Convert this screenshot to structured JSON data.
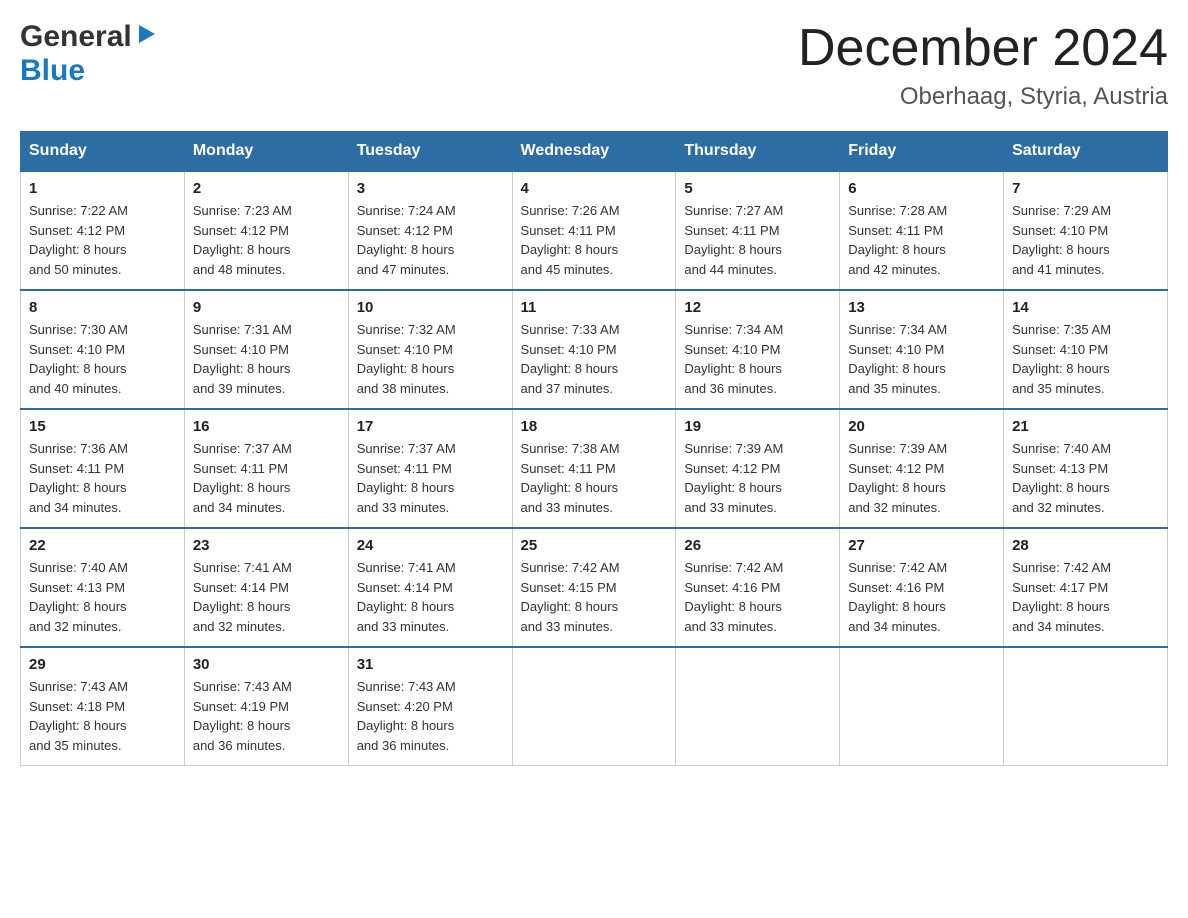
{
  "logo": {
    "general": "General",
    "blue": "Blue",
    "arrow": "▶"
  },
  "title": {
    "month_year": "December 2024",
    "location": "Oberhaag, Styria, Austria"
  },
  "days_of_week": [
    "Sunday",
    "Monday",
    "Tuesday",
    "Wednesday",
    "Thursday",
    "Friday",
    "Saturday"
  ],
  "weeks": [
    [
      {
        "day": "1",
        "sunrise": "7:22 AM",
        "sunset": "4:12 PM",
        "daylight_hours": "8",
        "daylight_minutes": "50"
      },
      {
        "day": "2",
        "sunrise": "7:23 AM",
        "sunset": "4:12 PM",
        "daylight_hours": "8",
        "daylight_minutes": "48"
      },
      {
        "day": "3",
        "sunrise": "7:24 AM",
        "sunset": "4:12 PM",
        "daylight_hours": "8",
        "daylight_minutes": "47"
      },
      {
        "day": "4",
        "sunrise": "7:26 AM",
        "sunset": "4:11 PM",
        "daylight_hours": "8",
        "daylight_minutes": "45"
      },
      {
        "day": "5",
        "sunrise": "7:27 AM",
        "sunset": "4:11 PM",
        "daylight_hours": "8",
        "daylight_minutes": "44"
      },
      {
        "day": "6",
        "sunrise": "7:28 AM",
        "sunset": "4:11 PM",
        "daylight_hours": "8",
        "daylight_minutes": "42"
      },
      {
        "day": "7",
        "sunrise": "7:29 AM",
        "sunset": "4:10 PM",
        "daylight_hours": "8",
        "daylight_minutes": "41"
      }
    ],
    [
      {
        "day": "8",
        "sunrise": "7:30 AM",
        "sunset": "4:10 PM",
        "daylight_hours": "8",
        "daylight_minutes": "40"
      },
      {
        "day": "9",
        "sunrise": "7:31 AM",
        "sunset": "4:10 PM",
        "daylight_hours": "8",
        "daylight_minutes": "39"
      },
      {
        "day": "10",
        "sunrise": "7:32 AM",
        "sunset": "4:10 PM",
        "daylight_hours": "8",
        "daylight_minutes": "38"
      },
      {
        "day": "11",
        "sunrise": "7:33 AM",
        "sunset": "4:10 PM",
        "daylight_hours": "8",
        "daylight_minutes": "37"
      },
      {
        "day": "12",
        "sunrise": "7:34 AM",
        "sunset": "4:10 PM",
        "daylight_hours": "8",
        "daylight_minutes": "36"
      },
      {
        "day": "13",
        "sunrise": "7:34 AM",
        "sunset": "4:10 PM",
        "daylight_hours": "8",
        "daylight_minutes": "35"
      },
      {
        "day": "14",
        "sunrise": "7:35 AM",
        "sunset": "4:10 PM",
        "daylight_hours": "8",
        "daylight_minutes": "35"
      }
    ],
    [
      {
        "day": "15",
        "sunrise": "7:36 AM",
        "sunset": "4:11 PM",
        "daylight_hours": "8",
        "daylight_minutes": "34"
      },
      {
        "day": "16",
        "sunrise": "7:37 AM",
        "sunset": "4:11 PM",
        "daylight_hours": "8",
        "daylight_minutes": "34"
      },
      {
        "day": "17",
        "sunrise": "7:37 AM",
        "sunset": "4:11 PM",
        "daylight_hours": "8",
        "daylight_minutes": "33"
      },
      {
        "day": "18",
        "sunrise": "7:38 AM",
        "sunset": "4:11 PM",
        "daylight_hours": "8",
        "daylight_minutes": "33"
      },
      {
        "day": "19",
        "sunrise": "7:39 AM",
        "sunset": "4:12 PM",
        "daylight_hours": "8",
        "daylight_minutes": "33"
      },
      {
        "day": "20",
        "sunrise": "7:39 AM",
        "sunset": "4:12 PM",
        "daylight_hours": "8",
        "daylight_minutes": "32"
      },
      {
        "day": "21",
        "sunrise": "7:40 AM",
        "sunset": "4:13 PM",
        "daylight_hours": "8",
        "daylight_minutes": "32"
      }
    ],
    [
      {
        "day": "22",
        "sunrise": "7:40 AM",
        "sunset": "4:13 PM",
        "daylight_hours": "8",
        "daylight_minutes": "32"
      },
      {
        "day": "23",
        "sunrise": "7:41 AM",
        "sunset": "4:14 PM",
        "daylight_hours": "8",
        "daylight_minutes": "32"
      },
      {
        "day": "24",
        "sunrise": "7:41 AM",
        "sunset": "4:14 PM",
        "daylight_hours": "8",
        "daylight_minutes": "33"
      },
      {
        "day": "25",
        "sunrise": "7:42 AM",
        "sunset": "4:15 PM",
        "daylight_hours": "8",
        "daylight_minutes": "33"
      },
      {
        "day": "26",
        "sunrise": "7:42 AM",
        "sunset": "4:16 PM",
        "daylight_hours": "8",
        "daylight_minutes": "33"
      },
      {
        "day": "27",
        "sunrise": "7:42 AM",
        "sunset": "4:16 PM",
        "daylight_hours": "8",
        "daylight_minutes": "34"
      },
      {
        "day": "28",
        "sunrise": "7:42 AM",
        "sunset": "4:17 PM",
        "daylight_hours": "8",
        "daylight_minutes": "34"
      }
    ],
    [
      {
        "day": "29",
        "sunrise": "7:43 AM",
        "sunset": "4:18 PM",
        "daylight_hours": "8",
        "daylight_minutes": "35"
      },
      {
        "day": "30",
        "sunrise": "7:43 AM",
        "sunset": "4:19 PM",
        "daylight_hours": "8",
        "daylight_minutes": "36"
      },
      {
        "day": "31",
        "sunrise": "7:43 AM",
        "sunset": "4:20 PM",
        "daylight_hours": "8",
        "daylight_minutes": "36"
      },
      null,
      null,
      null,
      null
    ]
  ]
}
